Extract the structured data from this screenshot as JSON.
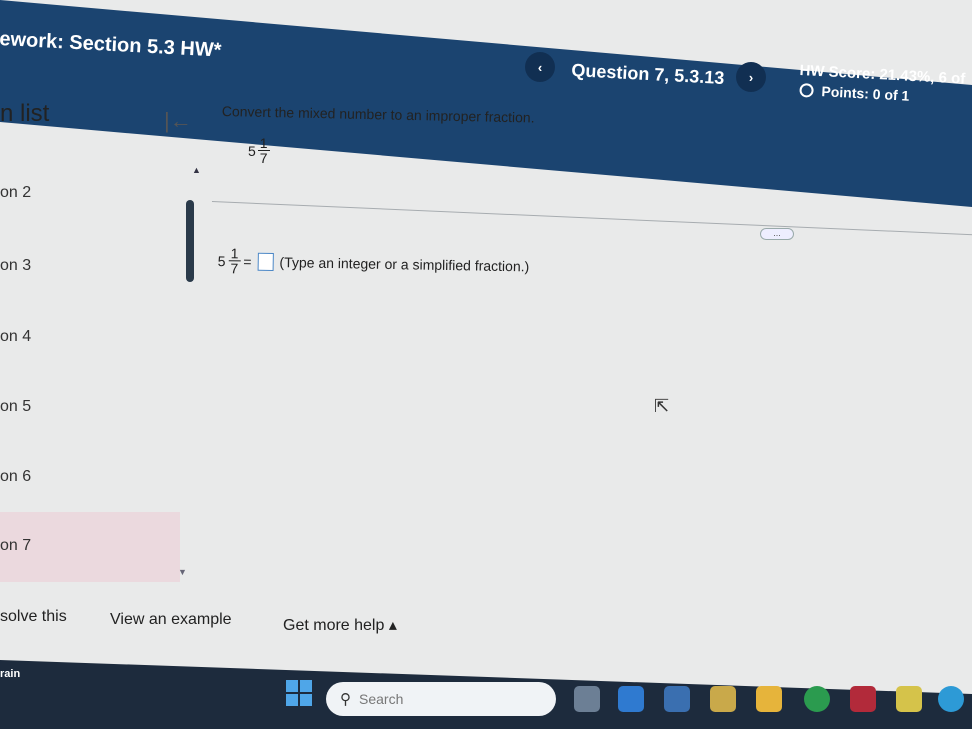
{
  "header": {
    "assignment_title": "ework:  Section 5.3 HW*",
    "question_title": "Question 7, 5.3.13",
    "prev_icon": "‹",
    "next_icon": "›",
    "score": "HW Score: 21.43%, 6 of",
    "points": "Points: 0 of 1"
  },
  "sidebar": {
    "title": "n list",
    "items": [
      {
        "label": "on 2"
      },
      {
        "label": "on 3"
      },
      {
        "label": "on 4"
      },
      {
        "label": "on 5"
      },
      {
        "label": "on 6"
      },
      {
        "label": "on 7"
      }
    ]
  },
  "question": {
    "instruction": "Convert the mixed number to an improper fraction.",
    "whole": "5",
    "numerator": "1",
    "denominator": "7",
    "equals": "=",
    "answer_hint": "(Type an integer or a simplified fraction.)",
    "more_label": "...",
    "answer_value": ""
  },
  "bottom": {
    "solve": "solve this",
    "example": "View an example",
    "help": "Get more help ▴"
  },
  "taskbar": {
    "weather": "rain",
    "search_placeholder": "Search"
  },
  "colors": {
    "header": "#1b4470",
    "active_item": "#ebd9de",
    "answer_box_border": "#4a86c5"
  }
}
